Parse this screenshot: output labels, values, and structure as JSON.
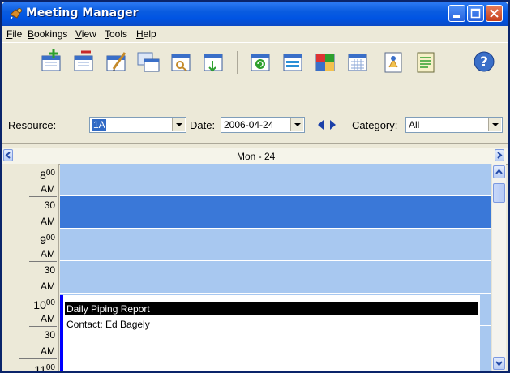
{
  "window": {
    "title": "Meeting Manager",
    "colors": {
      "titlebar": "#0054e3",
      "slot_light": "#a8c8f0",
      "slot_selected": "#3a78d8",
      "event_marker": "#0000ff"
    }
  },
  "menu": [
    {
      "label": "File",
      "accel": "F",
      "rest": "ile"
    },
    {
      "label": "Bookings",
      "accel": "B",
      "rest": "ookings"
    },
    {
      "label": "View",
      "accel": "V",
      "rest": "iew"
    },
    {
      "label": "Tools",
      "accel": "T",
      "rest": "ools"
    },
    {
      "label": "Help",
      "accel": "H",
      "rest": "elp"
    }
  ],
  "toolbar": {
    "buttons": [
      "new-booking-icon",
      "delete-booking-icon",
      "edit-booking-icon",
      "copy-booking-icon",
      "find-booking-icon",
      "export-booking-icon",
      "refresh-icon",
      "day-view-icon",
      "colored-view-icon",
      "month-view-icon",
      "report-icon",
      "notes-icon",
      "help-icon"
    ]
  },
  "filters": {
    "resource_label": "Resource:",
    "resource_value": "1A",
    "date_label": "Date:",
    "date_value": "2006-04-24",
    "category_label": "Category:",
    "category_value": "All"
  },
  "schedule": {
    "day_header": "Mon - 24",
    "times": [
      {
        "hour": "8",
        "min": "00",
        "ampm": "AM"
      },
      {
        "hour": "",
        "min": "30",
        "ampm": "AM"
      },
      {
        "hour": "9",
        "min": "00",
        "ampm": "AM"
      },
      {
        "hour": "",
        "min": "30",
        "ampm": "AM"
      },
      {
        "hour": "10",
        "min": "00",
        "ampm": "AM"
      },
      {
        "hour": "",
        "min": "30",
        "ampm": "AM"
      },
      {
        "hour": "11",
        "min": "00",
        "ampm": ""
      }
    ],
    "event": {
      "title": "Daily Piping Report",
      "contact": "Contact: Ed Bagely"
    }
  }
}
